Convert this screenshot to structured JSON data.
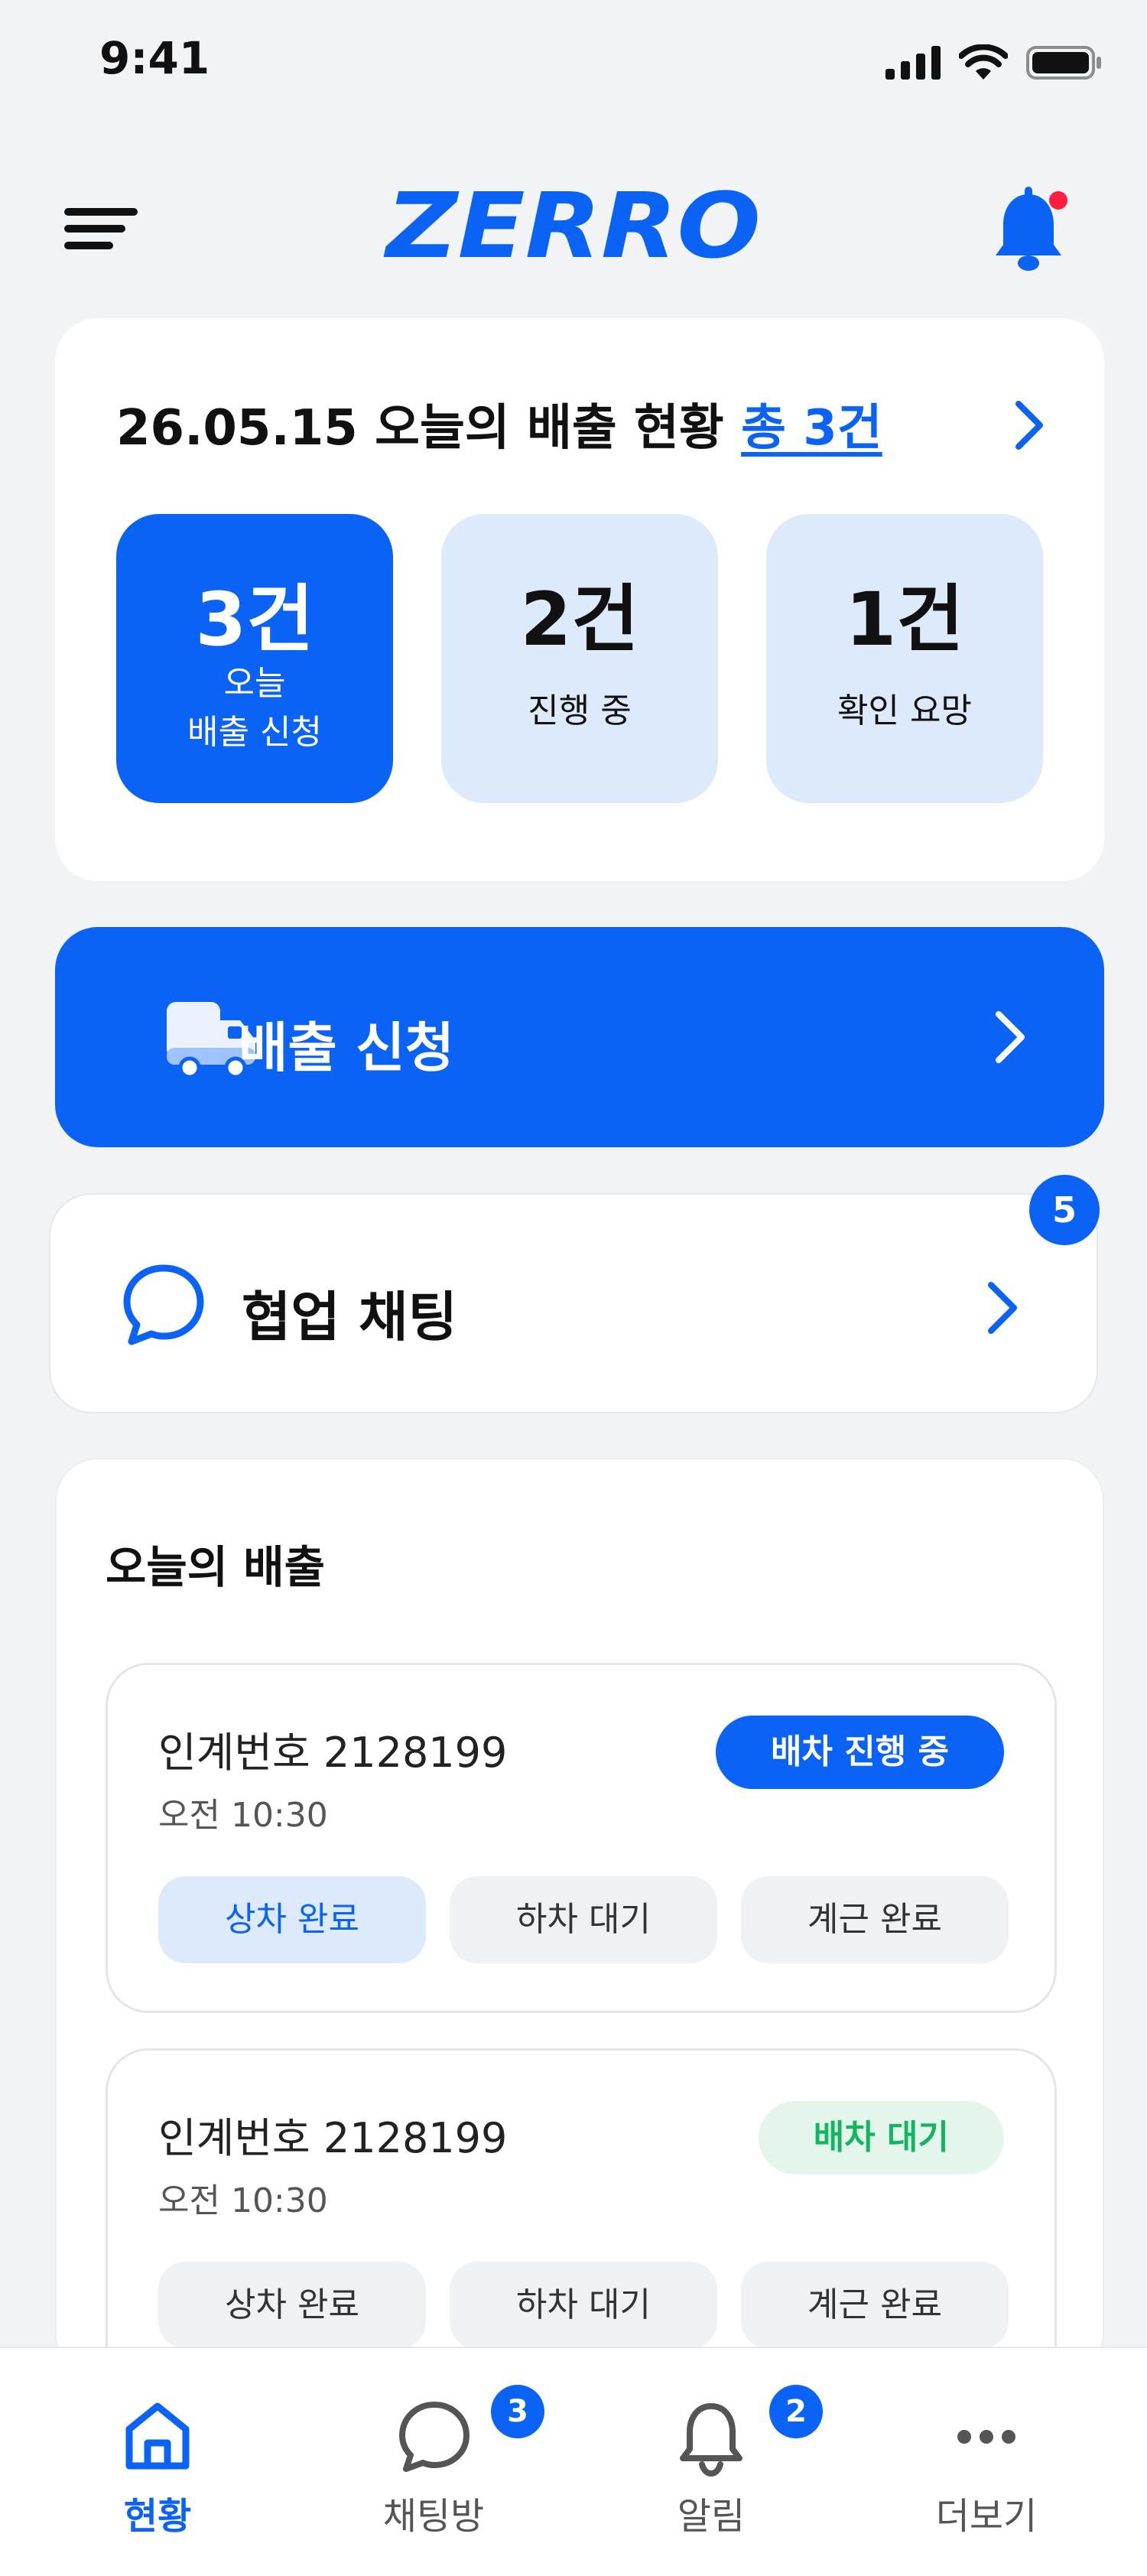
{
  "status_bar": {
    "time": "9:41"
  },
  "header": {
    "logo_text": "ZERRO"
  },
  "summary": {
    "title": "26.05.15 오늘의 배출 현황 ",
    "total": "총 3건",
    "stats": [
      {
        "value": "3건",
        "label": "오늘\n배출 신청",
        "active": true
      },
      {
        "value": "2건",
        "label": "진행 중",
        "active": false
      },
      {
        "value": "1건",
        "label": "확인 요망",
        "active": false
      }
    ]
  },
  "dispatch": {
    "label": "배출 신청"
  },
  "chat": {
    "label": "협업 채팅",
    "badge": "5"
  },
  "today": {
    "title": "오늘의 배출",
    "items": [
      {
        "id": "인계번호 2128199",
        "time": "오전 10:30",
        "status": "배차 진행 중",
        "status_color": "#0a63f5",
        "steps": [
          "상차 완료",
          "하차 대기",
          "계근 완료"
        ]
      },
      {
        "id": "인계번호 2128199",
        "time": "오전 10:30",
        "status": "배차 대기",
        "status_color": "#14b463",
        "steps": [
          "상차 완료",
          "하차 대기",
          "계근 완료"
        ]
      }
    ]
  },
  "bottom_nav": {
    "items": [
      {
        "label": "현황",
        "icon": "home-icon",
        "active": true
      },
      {
        "label": "채팅방",
        "icon": "chat-icon",
        "badge": "3"
      },
      {
        "label": "알림",
        "icon": "bell-icon",
        "badge": "2"
      },
      {
        "label": "더보기",
        "icon": "more-icon"
      }
    ]
  },
  "colors": {
    "accent": "#0a63f5",
    "accent_light": "#dceafc",
    "success": "#14b463",
    "notification_dot": "#ff1f3d"
  }
}
